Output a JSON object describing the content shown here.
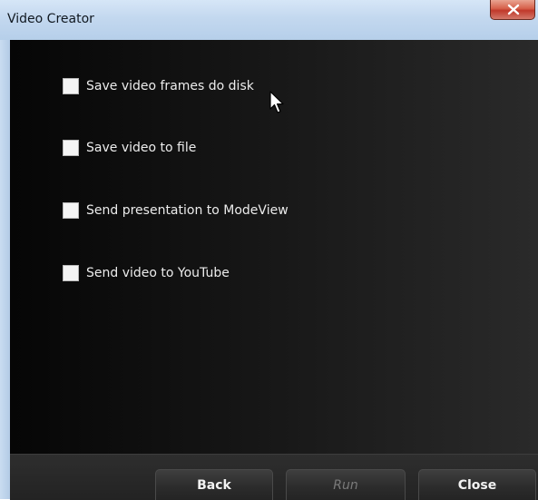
{
  "window": {
    "title": "Video Creator"
  },
  "options": [
    {
      "label": "Save video frames do disk",
      "checked": false
    },
    {
      "label": "Save video to file",
      "checked": false
    },
    {
      "label": "Send presentation to ModeView",
      "checked": false
    },
    {
      "label": "Send video to YouTube",
      "checked": false
    }
  ],
  "footer": {
    "back_label": "Back",
    "run_label": "Run",
    "close_label": "Close"
  }
}
